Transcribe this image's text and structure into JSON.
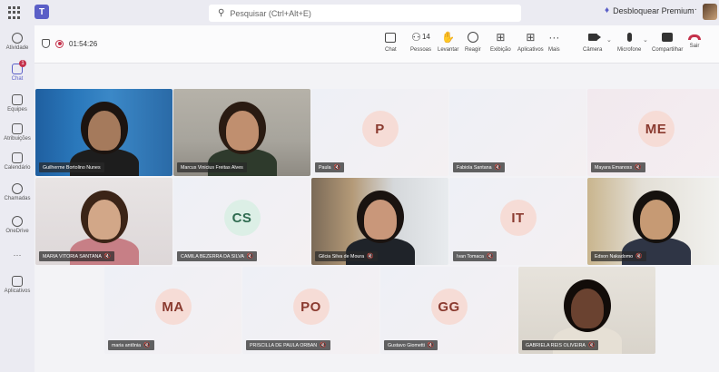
{
  "titlebar": {
    "search_placeholder": "Pesquisar (Ctrl+Alt+E)",
    "unlock_label": "Desbloquear Premium",
    "more": "···"
  },
  "rail": [
    {
      "label": "Atividade",
      "icon": "bell-icon",
      "badge": ""
    },
    {
      "label": "Chat",
      "icon": "chat-icon",
      "badge": "1"
    },
    {
      "label": "Equipes",
      "icon": "teams-icon",
      "badge": ""
    },
    {
      "label": "Atribuições",
      "icon": "assignments-icon",
      "badge": ""
    },
    {
      "label": "Calendário",
      "icon": "calendar-icon",
      "badge": ""
    },
    {
      "label": "Chamadas",
      "icon": "phone-icon",
      "badge": ""
    },
    {
      "label": "OneDrive",
      "icon": "onedrive-icon",
      "badge": ""
    },
    {
      "label": "···",
      "icon": "more-icon",
      "badge": ""
    },
    {
      "label": "Aplicativos",
      "icon": "apps-icon",
      "badge": ""
    }
  ],
  "meeting": {
    "timer": "01:54:26",
    "people_count": "14"
  },
  "toolbar": {
    "chat": "Chat",
    "people": "Pessoas",
    "raise": "Levantar",
    "react": "Reagir",
    "view": "Exibição",
    "apps": "Aplicativos",
    "more": "Mais",
    "camera": "Câmera",
    "mic": "Microfone",
    "share": "Compartilhar",
    "leave": "Sair"
  },
  "participants": [
    {
      "name": "Guilherme Bortolino Nunes",
      "initials": "",
      "video": true
    },
    {
      "name": "Marcus Vinicius Freitas Alves",
      "initials": "",
      "video": true
    },
    {
      "name": "Paula",
      "initials": "P",
      "video": false
    },
    {
      "name": "Fabiola Santana",
      "initials": "",
      "video": false
    },
    {
      "name": "Mayara Emanoss",
      "initials": "ME",
      "video": false
    },
    {
      "name": "MARIA VITORIA SANTANA",
      "initials": "",
      "video": true
    },
    {
      "name": "CAMILA BEZERRA DA SILVA",
      "initials": "CS",
      "video": false
    },
    {
      "name": "Gilcia Silva de Moura",
      "initials": "",
      "video": true
    },
    {
      "name": "Ivan Tomaca",
      "initials": "IT",
      "video": false
    },
    {
      "name": "Edson Nakadomo",
      "initials": "",
      "video": true
    },
    {
      "name": "maria antônia",
      "initials": "MA",
      "video": false
    },
    {
      "name": "PRISCILLA DE PAULA ORBAN",
      "initials": "PO",
      "video": false
    },
    {
      "name": "Gustavo Giometti",
      "initials": "GG",
      "video": false
    },
    {
      "name": "GABRIELA REIS OLIVEIRA",
      "initials": "",
      "video": true
    }
  ],
  "colors": {
    "accent": "#5b5fc7",
    "leave_red": "#c4314b",
    "initials_bg": "#f6dcd6",
    "initials_bg_alt": "#dcefe6",
    "initials_text": "#8a3a2f",
    "initials_text_alt": "#2f6b50"
  }
}
